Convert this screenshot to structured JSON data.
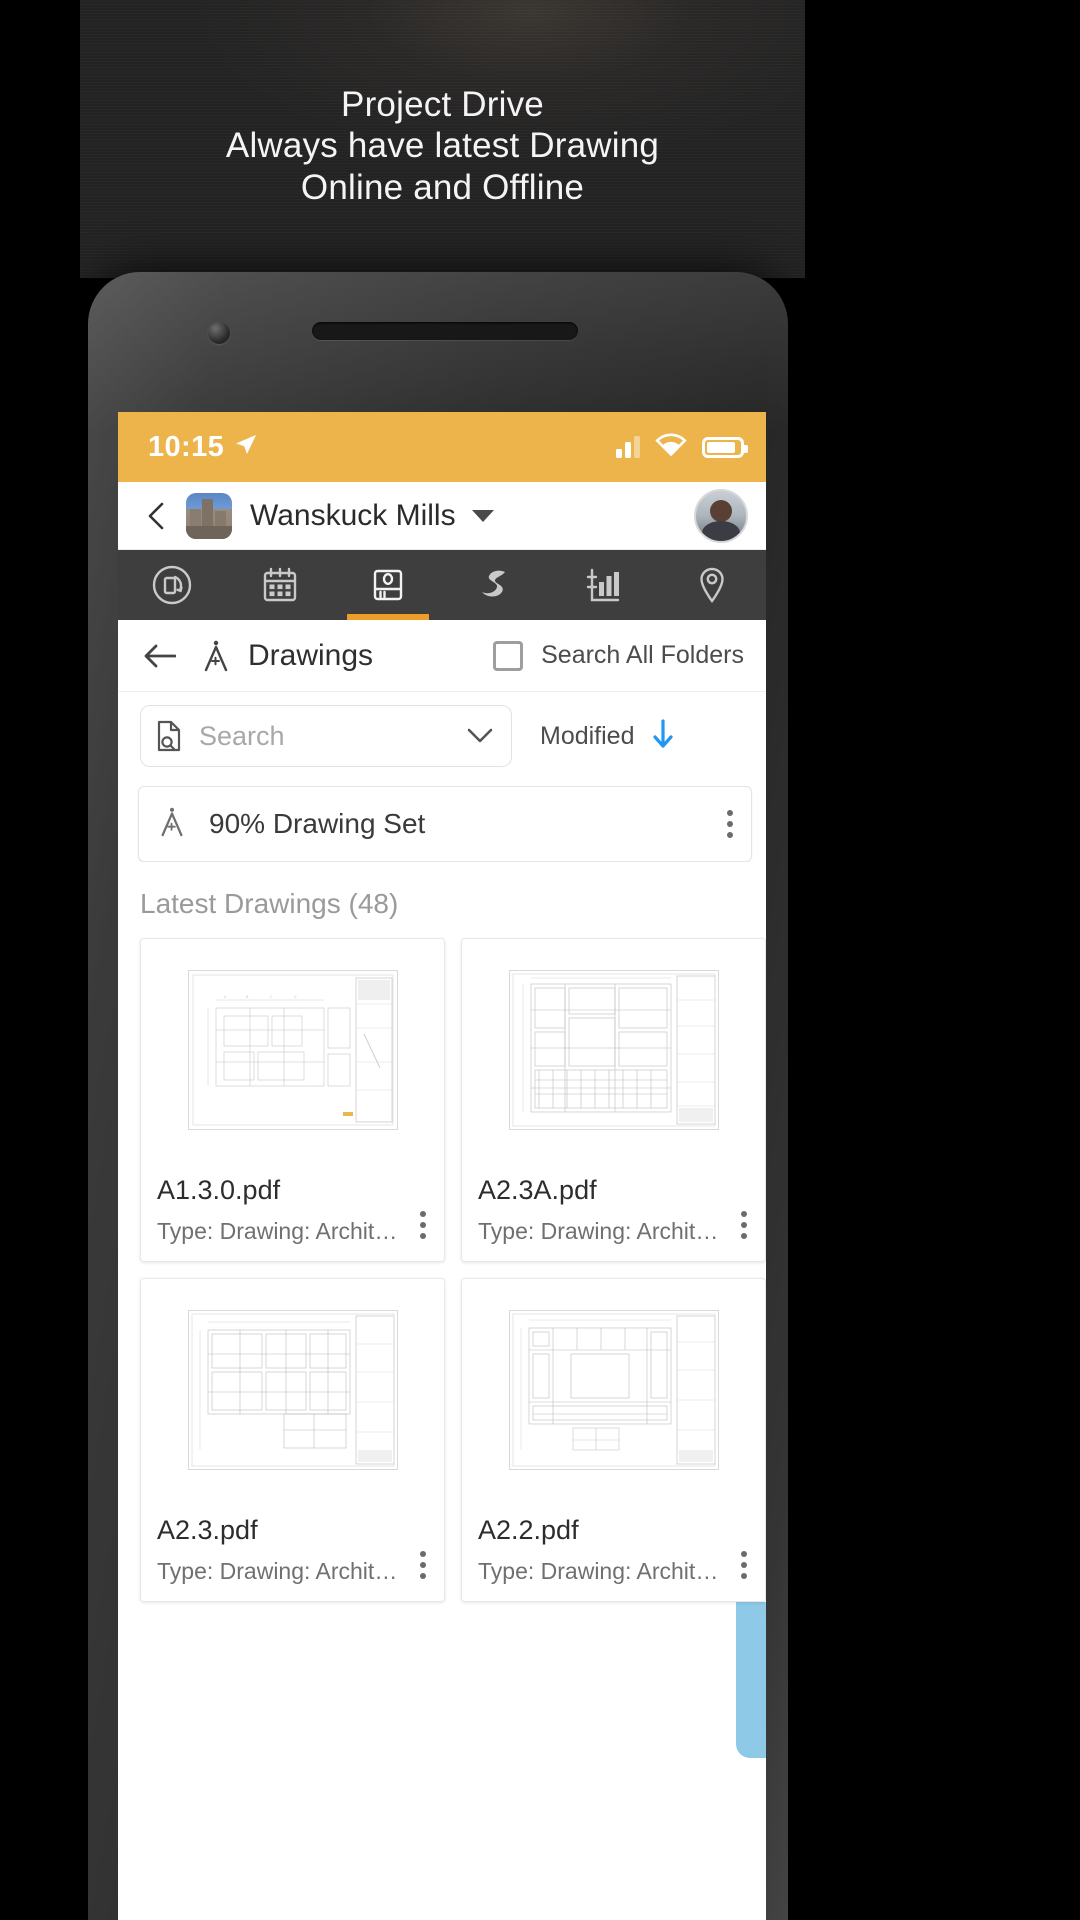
{
  "promo": {
    "lines": [
      "Project Drive",
      "Always have latest Drawing",
      "Online and Offline"
    ]
  },
  "statusbar": {
    "time": "10:15",
    "location_icon": "location-arrow-icon",
    "signal_icon": "signal-bars-icon",
    "wifi_icon": "wifi-icon",
    "battery_icon": "battery-icon",
    "bg_color": "#EDB44C"
  },
  "navbar": {
    "back_icon": "chevron-left-icon",
    "project_thumb": "project-thumbnail",
    "project_name": "Wanskuck Mills",
    "dropdown_icon": "caret-down-icon",
    "avatar": "user-avatar"
  },
  "tabs": [
    {
      "name": "sync",
      "icon": "device-rotate-icon",
      "active": false
    },
    {
      "name": "calendar",
      "icon": "calendar-icon",
      "active": false
    },
    {
      "name": "drawings",
      "icon": "drawing-book-icon",
      "active": true
    },
    {
      "name": "s-curve",
      "icon": "s-curve-icon",
      "active": false
    },
    {
      "name": "reports",
      "icon": "bar-chart-icon",
      "active": false
    },
    {
      "name": "location",
      "icon": "map-pin-icon",
      "active": false
    }
  ],
  "tab_accent_color": "#EE9D2B",
  "toolbar": {
    "back_icon": "arrow-left-icon",
    "compass_icon": "compass-icon",
    "title": "Drawings",
    "search_all_folders_label": "Search All Folders",
    "search_all_folders_checked": false
  },
  "search": {
    "icon": "document-search-icon",
    "placeholder": "Search",
    "value": "",
    "expand_icon": "chevron-down-icon"
  },
  "sort": {
    "label": "Modified",
    "direction_icon": "arrow-down-icon",
    "direction_color": "#2196F3"
  },
  "drawing_set": {
    "icon": "compass-icon",
    "label": "90% Drawing Set",
    "menu_icon": "kebab-menu-icon"
  },
  "section": {
    "title": "Latest Drawings (48)"
  },
  "files": [
    {
      "name": "A1.3.0.pdf",
      "type": "Type: Drawing: Architecture",
      "menu_icon": "kebab-menu-icon",
      "thumb": "floorplan-small"
    },
    {
      "name": "A2.3A.pdf",
      "type": "Type: Drawing: Architecture",
      "menu_icon": "kebab-menu-icon",
      "thumb": "floorplan-dense"
    },
    {
      "name": "A2.3.pdf",
      "type": "Type: Drawing: Architecture",
      "menu_icon": "kebab-menu-icon",
      "thumb": "floorplan-wide"
    },
    {
      "name": "A2.2.pdf",
      "type": "Type: Drawing: Architecture",
      "menu_icon": "kebab-menu-icon",
      "thumb": "floorplan-court"
    }
  ]
}
